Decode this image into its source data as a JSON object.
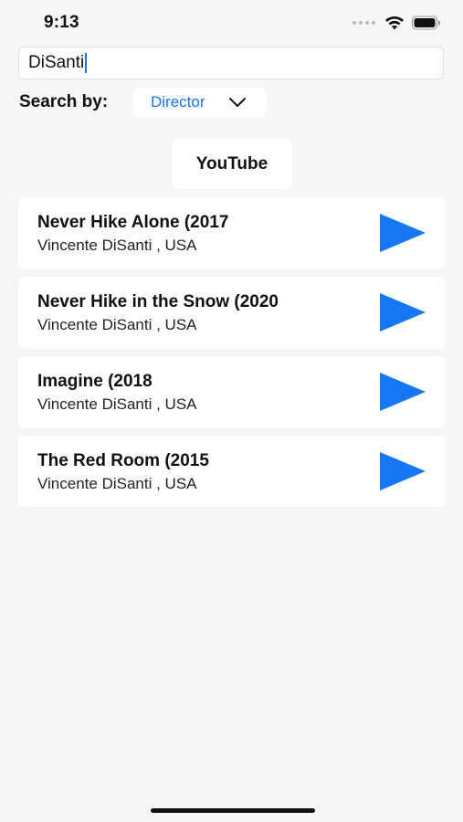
{
  "status_bar": {
    "time": "9:13",
    "icons": [
      "cellular-dots-icon",
      "wifi-icon",
      "battery-icon"
    ]
  },
  "search": {
    "value": "DiSanti",
    "placeholder": ""
  },
  "search_by": {
    "label": "Search by:",
    "selected": "Director",
    "icon": "chevron-down-icon"
  },
  "youtube_button": {
    "label": "YouTube"
  },
  "results": [
    {
      "title": "Never Hike Alone (2017",
      "subtitle": "Vincente DiSanti , USA"
    },
    {
      "title": "Never Hike in the Snow (2020",
      "subtitle": "Vincente DiSanti , USA"
    },
    {
      "title": "Imagine (2018",
      "subtitle": "Vincente DiSanti , USA"
    },
    {
      "title": "The Red Room (2015",
      "subtitle": "Vincente DiSanti , USA"
    }
  ],
  "colors": {
    "accent": "#1a73e8",
    "play": "#1677f2",
    "background": "#f6f6f6",
    "card": "#ffffff"
  }
}
